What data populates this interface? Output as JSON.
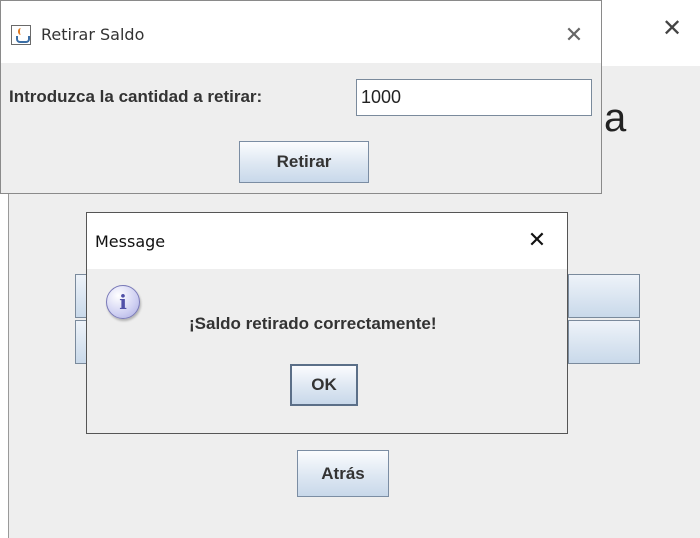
{
  "main_window": {
    "close_glyph": "✕",
    "partial_title": "a",
    "back_label": "Atrás"
  },
  "retirar_dialog": {
    "title": "Retirar Saldo",
    "close_glyph": "✕",
    "field_label": "Introduzca la cantidad a retirar:",
    "amount_value": "1000",
    "submit_label": "Retirar"
  },
  "message_dialog": {
    "title": "Message",
    "close_glyph": "✕",
    "icon": "info-icon",
    "icon_glyph": "i",
    "text": "¡Saldo retirado correctamente!",
    "ok_label": "OK"
  }
}
